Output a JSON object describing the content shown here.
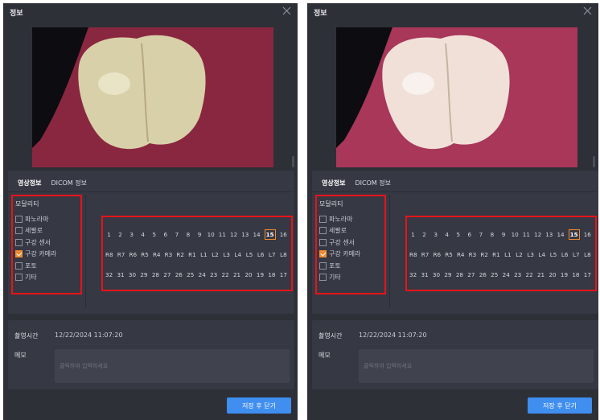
{
  "colors": {
    "dialog_bg": "#2e3038",
    "panel_bg": "#363843",
    "accent_orange": "#f08a30",
    "annotation_red": "#e8131a",
    "button_blue": "#3f8ef0"
  },
  "dialogs": [
    {
      "title": "정보",
      "close_icon": "close-icon",
      "tabs": [
        "영상정보",
        "DICOM 정보"
      ],
      "modality": {
        "title": "모달리티",
        "options": [
          {
            "label": "파노라마",
            "checked": false
          },
          {
            "label": "세팔로",
            "checked": false
          },
          {
            "label": "구강 센서",
            "checked": false
          },
          {
            "label": "구강 카메라",
            "checked": true
          },
          {
            "label": "포토",
            "checked": false
          },
          {
            "label": "기타",
            "checked": false
          }
        ]
      },
      "teeth": {
        "rows": [
          [
            "1",
            "2",
            "3",
            "4",
            "5",
            "6",
            "7",
            "8",
            "9",
            "10",
            "11",
            "12",
            "13",
            "14",
            "15",
            "16"
          ],
          [
            "R8",
            "R7",
            "R6",
            "R5",
            "R4",
            "R3",
            "R2",
            "R1",
            "L1",
            "L2",
            "L3",
            "L4",
            "L5",
            "L6",
            "L7",
            "L8"
          ],
          [
            "32",
            "31",
            "30",
            "29",
            "28",
            "27",
            "26",
            "25",
            "24",
            "23",
            "22",
            "21",
            "20",
            "19",
            "18",
            "17"
          ]
        ],
        "selected": "15"
      },
      "capture_time_label": "촬영시간",
      "capture_time_value": "12/22/2024 11:07:20",
      "memo_label": "메모",
      "memo_placeholder": "클릭하여 입력하세요",
      "memo_value": "",
      "save_button": "저장 후 닫기"
    },
    {
      "title": "정보",
      "close_icon": "close-icon",
      "tabs": [
        "영상정보",
        "DICOM 정보"
      ],
      "modality": {
        "title": "모달리티",
        "options": [
          {
            "label": "파노라마",
            "checked": false
          },
          {
            "label": "세팔로",
            "checked": false
          },
          {
            "label": "구강 센서",
            "checked": false
          },
          {
            "label": "구강 카메라",
            "checked": true
          },
          {
            "label": "포토",
            "checked": false
          },
          {
            "label": "기타",
            "checked": false
          }
        ]
      },
      "teeth": {
        "rows": [
          [
            "1",
            "2",
            "3",
            "4",
            "5",
            "6",
            "7",
            "8",
            "9",
            "10",
            "11",
            "12",
            "13",
            "14",
            "15",
            "16"
          ],
          [
            "R8",
            "R7",
            "R6",
            "R5",
            "R4",
            "R3",
            "R2",
            "R1",
            "L1",
            "L2",
            "L3",
            "L4",
            "L5",
            "L6",
            "L7",
            "L8"
          ],
          [
            "32",
            "31",
            "30",
            "29",
            "28",
            "27",
            "26",
            "25",
            "24",
            "23",
            "22",
            "21",
            "20",
            "19",
            "18",
            "17"
          ]
        ],
        "selected": "15"
      },
      "capture_time_label": "촬영시간",
      "capture_time_value": "12/22/2024 11:07:20",
      "memo_label": "메모",
      "memo_placeholder": "클릭하여 입력하세요",
      "memo_value": "",
      "save_button": "저장 후 닫기"
    }
  ]
}
